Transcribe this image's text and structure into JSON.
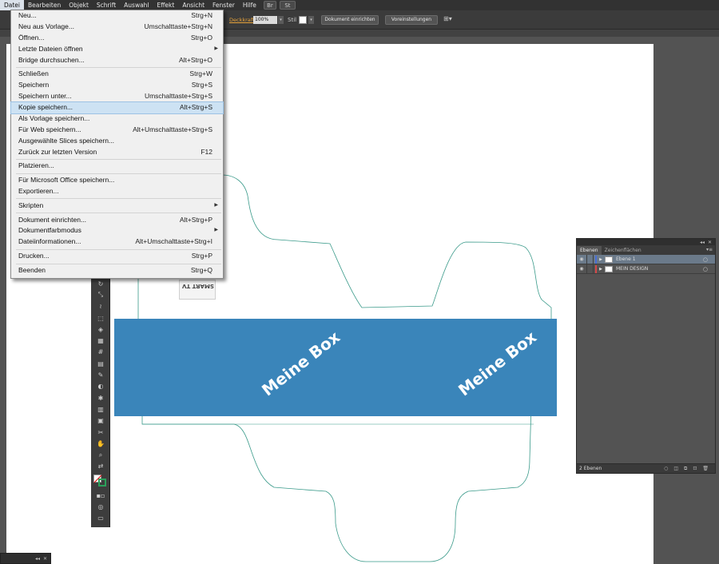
{
  "menubar": {
    "items": [
      "Datei",
      "Bearbeiten",
      "Objekt",
      "Schrift",
      "Auswahl",
      "Effekt",
      "Ansicht",
      "Fenster",
      "Hilfe"
    ],
    "buttons": [
      "Br",
      "St"
    ]
  },
  "controlbar": {
    "opacity_label": "Deckkraft",
    "opacity_value": "100%",
    "style_label": "Stil",
    "document_setup": "Dokument einrichten",
    "preferences": "Voreinstellungen"
  },
  "menu": {
    "rows": [
      {
        "label": "Neu...",
        "shortcut": "Strg+N"
      },
      {
        "label": "Neu aus Vorlage...",
        "shortcut": "Umschalttaste+Strg+N"
      },
      {
        "label": "Öffnen...",
        "shortcut": "Strg+O"
      },
      {
        "label": "Letzte Dateien öffnen",
        "shortcut": "",
        "submenu": true
      },
      {
        "label": "Bridge durchsuchen...",
        "shortcut": "Alt+Strg+O"
      },
      {
        "sep": true
      },
      {
        "label": "Schließen",
        "shortcut": "Strg+W"
      },
      {
        "label": "Speichern",
        "shortcut": "Strg+S"
      },
      {
        "label": "Speichern unter...",
        "shortcut": "Umschalttaste+Strg+S"
      },
      {
        "label": "Kopie speichern...",
        "shortcut": "Alt+Strg+S",
        "highlight": true
      },
      {
        "label": "Als Vorlage speichern...",
        "shortcut": ""
      },
      {
        "label": "Für Web speichern...",
        "shortcut": "Alt+Umschalttaste+Strg+S"
      },
      {
        "label": "Ausgewählte Slices speichern...",
        "shortcut": ""
      },
      {
        "label": "Zurück zur letzten Version",
        "shortcut": "F12"
      },
      {
        "sep": true
      },
      {
        "label": "Platzieren...",
        "shortcut": ""
      },
      {
        "sep": true
      },
      {
        "label": "Für Microsoft Office speichern...",
        "shortcut": ""
      },
      {
        "label": "Exportieren...",
        "shortcut": ""
      },
      {
        "sep": true
      },
      {
        "label": "Skripten",
        "shortcut": "",
        "submenu": true
      },
      {
        "sep": true
      },
      {
        "label": "Dokument einrichten...",
        "shortcut": "Alt+Strg+P"
      },
      {
        "label": "Dokumentfarbmodus",
        "shortcut": "",
        "submenu": true
      },
      {
        "label": "Dateiinformationen...",
        "shortcut": "Alt+Umschalttaste+Strg+I"
      },
      {
        "sep": true
      },
      {
        "label": "Drucken...",
        "shortcut": "Strg+P"
      },
      {
        "sep": true
      },
      {
        "label": "Beenden",
        "shortcut": "Strg+Q"
      }
    ]
  },
  "artboard": {
    "box_text_left": "Meine Box",
    "box_text_right": "Meine Box",
    "thumb_text": "SMART TV",
    "band_color": "#3a85ba",
    "dieline_color": "#3a9a8a"
  },
  "layers_panel": {
    "tab_layers": "Ebenen",
    "tab_artboards": "Zeichenflächen",
    "layers": [
      {
        "name": "Ebene 1",
        "color": "#4a6fd6",
        "selected": true
      },
      {
        "name": "MEIN DESIGN",
        "color": "#d64a4a",
        "selected": false
      }
    ],
    "footer": "2 Ebenen"
  },
  "tools": {
    "icons": [
      "rotate-icon",
      "scale-icon",
      "warp-icon",
      "free-transform-icon",
      "shape-builder-icon",
      "perspective-icon",
      "mesh-icon",
      "gradient-icon",
      "eyedropper-icon",
      "blend-icon",
      "symbol-sprayer-icon",
      "graph-icon",
      "artboard-icon",
      "slice-icon",
      "hand-icon",
      "zoom-icon"
    ],
    "glyphs": [
      "↻",
      "⤡",
      "≀",
      "⬚",
      "◈",
      "▦",
      "#",
      "▤",
      "✎",
      "◐",
      "✱",
      "▥",
      "▣",
      "✂",
      "✋",
      "⌕"
    ]
  }
}
